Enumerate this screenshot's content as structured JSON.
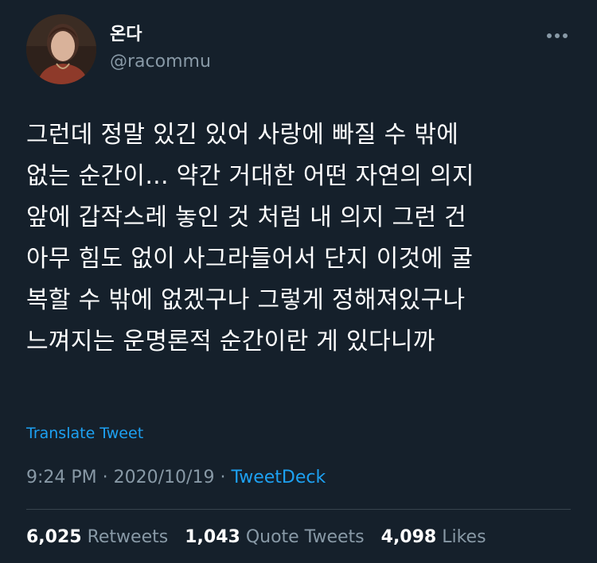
{
  "user": {
    "display_name": "온다",
    "handle": "@racommu",
    "avatar_icon": "profile-photo"
  },
  "more_icon": "ellipsis-icon",
  "tweet": {
    "lines": [
      "그런데 정말 있긴 있어 사랑에 빠질 수 밖에",
      "없는 순간이... 약간 거대한 어떤 자연의 의지",
      "앞에 갑작스레 놓인 것 처럼 내 의지 그런 건",
      "아무 힘도 없이 사그라들어서 단지 이것에 굴",
      "복할 수 밖에 없겠구나 그렇게 정해져있구나",
      "느껴지는 운명론적 순간이란 게 있다니까"
    ],
    "translate_label": "Translate Tweet",
    "time": "9:24 PM",
    "separator": " · ",
    "date": "2020/10/19",
    "source": "TweetDeck"
  },
  "stats": {
    "retweets_count": "6,025",
    "retweets_label": "Retweets",
    "quotes_count": "1,043",
    "quotes_label": "Quote Tweets",
    "likes_count": "4,098",
    "likes_label": "Likes"
  },
  "colors": {
    "background": "#15202b",
    "text": "#ffffff",
    "secondary": "#8899a6",
    "accent": "#1da1f2",
    "divider": "#38444d"
  }
}
